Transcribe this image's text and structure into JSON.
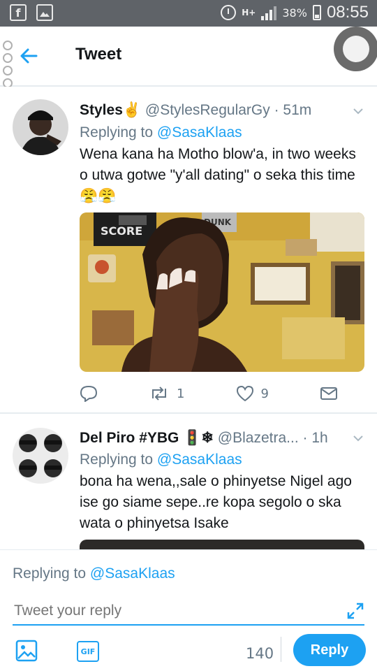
{
  "status_bar": {
    "network": "H+",
    "battery_pct": "38%",
    "time": "08:55",
    "left_icons": [
      "facebook-icon",
      "gallery-icon"
    ]
  },
  "header": {
    "title": "Tweet"
  },
  "tweets": [
    {
      "name": "Styles✌",
      "handle": "@StylesRegularGy",
      "time": "· 51m",
      "replying_prefix": "Replying to ",
      "replying_to": "@SasaKlaas",
      "text": "Wena kana ha Motho blow'a, in two weeks o utwa gotwe \"y'all dating\" o seka this time😤😤",
      "image_text": {
        "sign": "SCORE",
        "poster": "DUNK"
      },
      "retweets": "1",
      "likes": "9"
    },
    {
      "name": "Del Piro #YBG 🚦❄",
      "handle": "@Blazetra...",
      "time": "· 1h",
      "replying_prefix": "Replying to ",
      "replying_to": "@SasaKlaas",
      "text": "bona ha wena,,sale o phinyetse Nigel ago ise go siame sepe..re kopa segolo o ska wata o phinyetsa Isake"
    }
  ],
  "composer": {
    "replying_prefix": "Replying to ",
    "replying_to": "@SasaKlaas",
    "placeholder": "Tweet your reply",
    "gif_label": "GIF",
    "char_count": "140",
    "reply_label": "Reply"
  },
  "colors": {
    "accent": "#1da1f2",
    "secondary_text": "#657786",
    "status_bar": "#5f6368"
  }
}
